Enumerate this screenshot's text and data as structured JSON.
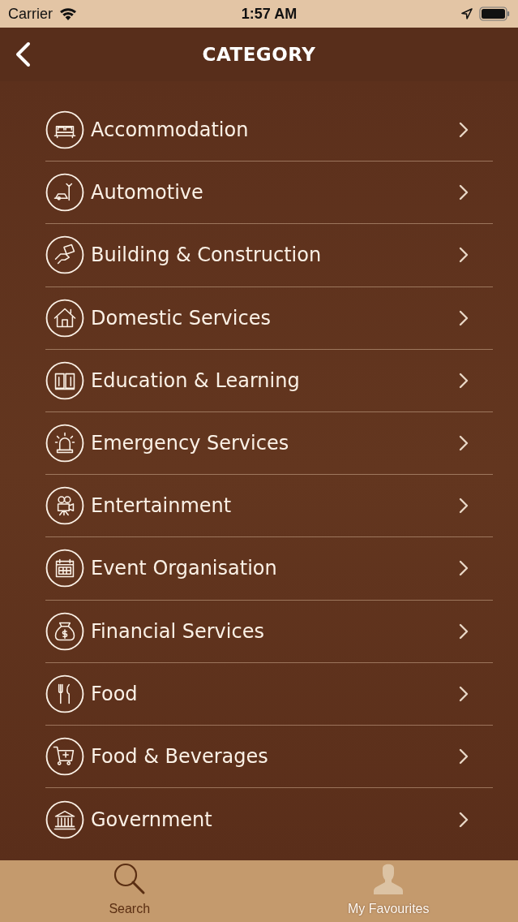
{
  "status_bar": {
    "carrier": "Carrier",
    "time": "1:57 AM"
  },
  "nav_bar": {
    "title": "CATEGORY"
  },
  "categories": [
    {
      "label": "Accommodation"
    },
    {
      "label": "Automotive"
    },
    {
      "label": "Building & Construction"
    },
    {
      "label": "Domestic Services"
    },
    {
      "label": "Education & Learning"
    },
    {
      "label": "Emergency Services"
    },
    {
      "label": "Entertainment"
    },
    {
      "label": "Event Organisation"
    },
    {
      "label": "Financial Services"
    },
    {
      "label": "Food"
    },
    {
      "label": "Food & Beverages"
    },
    {
      "label": "Government"
    }
  ],
  "tab_bar": [
    {
      "label": "Search",
      "kind": "search",
      "selected": true
    },
    {
      "label": "My Favourites",
      "kind": "person",
      "selected": false
    }
  ]
}
